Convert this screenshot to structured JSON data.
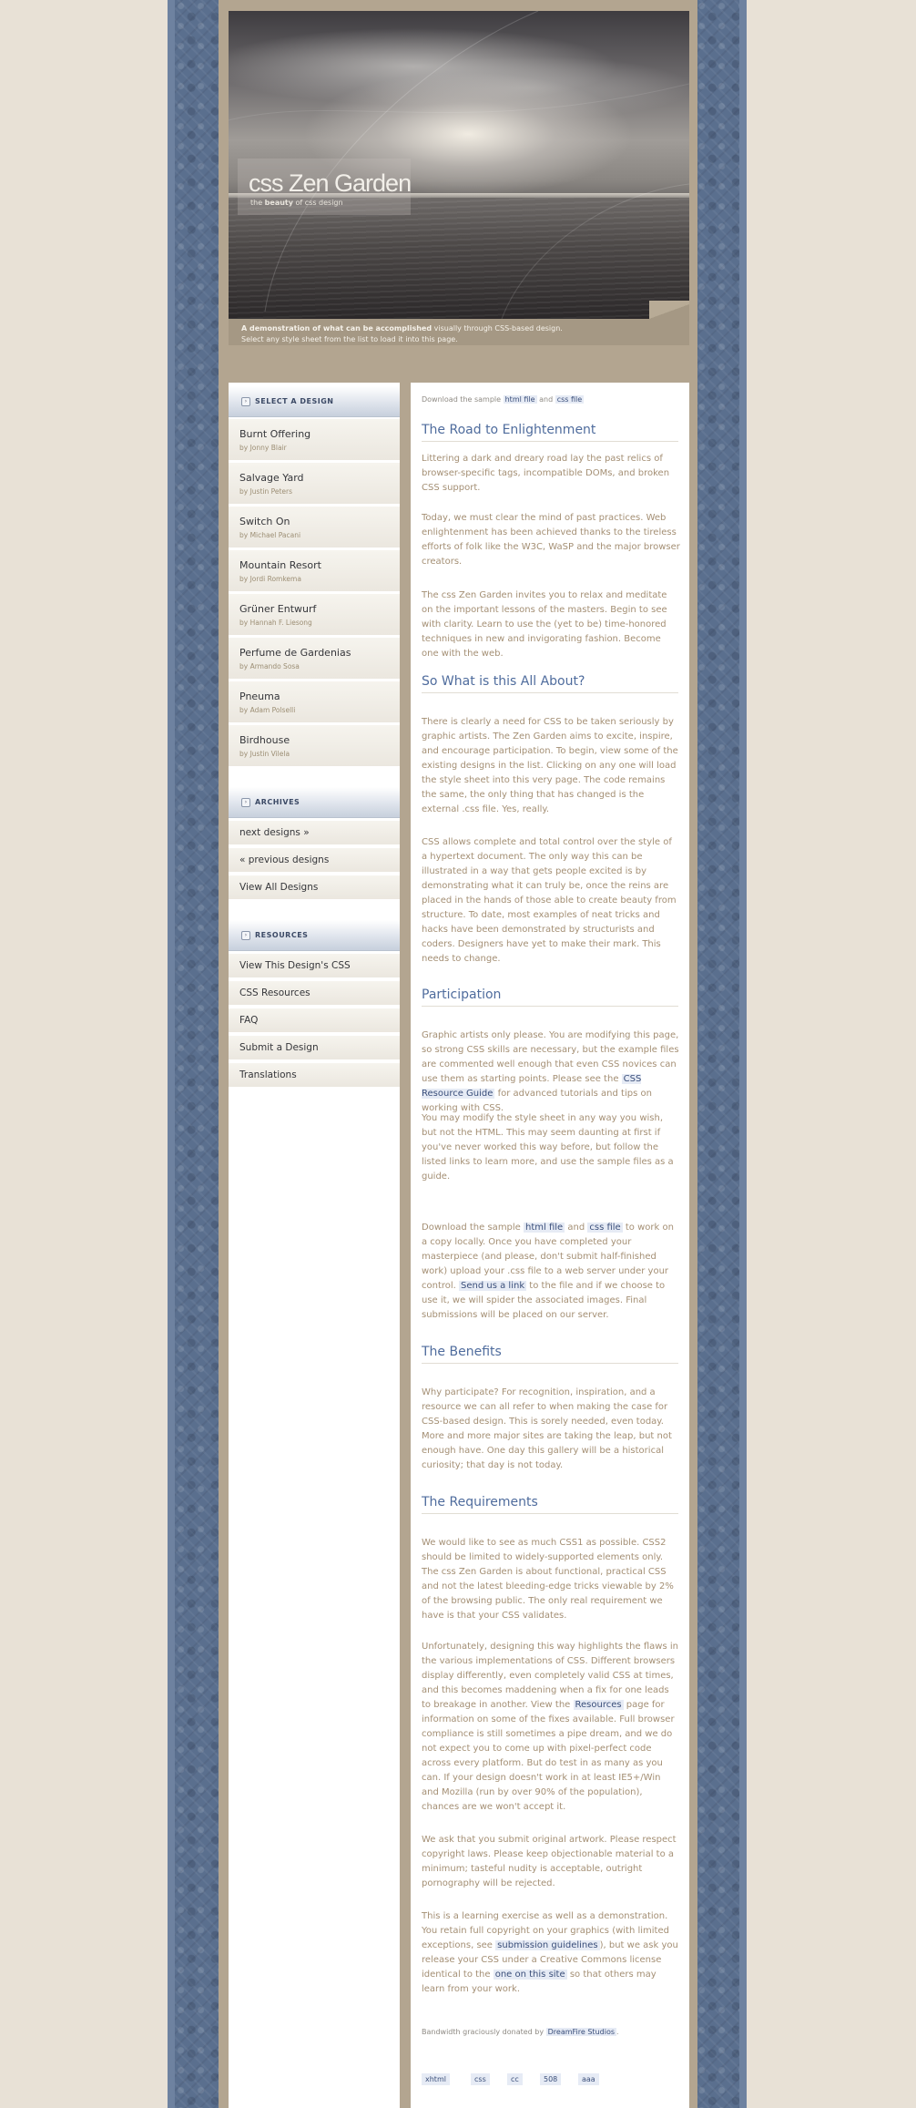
{
  "header": {
    "site_title": "css Zen Garden",
    "tagline_pre": "the ",
    "tagline_bold": "beauty",
    "tagline_post": " of css design",
    "summary_bold": "A demonstration of what can be accomplished",
    "summary_rest": " visually through CSS-based design.",
    "summary_line2": "Select any style sheet from the list to load it into this page."
  },
  "sidebar": {
    "select_heading": "SELECT A DESIGN",
    "designs": [
      {
        "name": "Burnt Offering",
        "author": "by Jonny Blair"
      },
      {
        "name": "Salvage Yard",
        "author": "by Justin Peters"
      },
      {
        "name": "Switch On",
        "author": "by Michael Pacani"
      },
      {
        "name": "Mountain Resort",
        "author": "by Jordi Romkema"
      },
      {
        "name": "Grüner Entwurf",
        "author": "by Hannah F. Liesong"
      },
      {
        "name": "Perfume de Gardenias",
        "author": "by Armando Sosa"
      },
      {
        "name": "Pneuma",
        "author": "by Adam Polselli"
      },
      {
        "name": "Birdhouse",
        "author": "by Justin Vilela"
      }
    ],
    "archives_heading": "ARCHIVES",
    "archives": [
      "next designs »",
      "« previous designs",
      "View All Designs"
    ],
    "resources_heading": "RESOURCES",
    "resources": [
      "View This Design's CSS",
      "CSS Resources",
      "FAQ",
      "Submit a Design",
      "Translations"
    ]
  },
  "main": {
    "download_pre": "Download the sample ",
    "html_file": "html file",
    "and": " and ",
    "css_file": "css file",
    "h_road": "The Road to Enlightenment",
    "p_road1": "Littering a dark and dreary road lay the past relics of browser-specific tags, incompatible DOMs, and broken CSS support.",
    "p_road2": "Today, we must clear the mind of past practices. Web enlightenment has been achieved thanks to the tireless efforts of folk like the W3C, WaSP and the major browser creators.",
    "p_road3": "The css Zen Garden invites you to relax and meditate on the important lessons of the masters. Begin to see with clarity. Learn to use the (yet to be) time-honored techniques in new and invigorating fashion. Become one with the web.",
    "h_what": "So What is this All About?",
    "p_what1": "There is clearly a need for CSS to be taken seriously by graphic artists. The Zen Garden aims to excite, inspire, and encourage participation. To begin, view some of the existing designs in the list. Clicking on any one will load the style sheet into this very page. The code remains the same, the only thing that has changed is the external .css file. Yes, really.",
    "p_what2": "CSS allows complete and total control over the style of a hypertext document. The only way this can be illustrated in a way that gets people excited is by demonstrating what it can truly be, once the reins are placed in the hands of those able to create beauty from structure. To date, most examples of neat tricks and hacks have been demonstrated by structurists and coders. Designers have yet to make their mark. This needs to change.",
    "h_part": "Participation",
    "p_part1_pre": "Graphic artists only please. You are modifying this page, so strong CSS skills are necessary, but the example files are commented well enough that even CSS novices can use them as starting points. Please see the ",
    "p_part1_link": "CSS Resource Guide",
    "p_part1_post": " for advanced tutorials and tips on working with CSS.",
    "p_part2": "You may modify the style sheet in any way you wish, but not the HTML. This may seem daunting at first if you've never worked this way before, but follow the listed links to learn more, and use the sample files as a guide.",
    "p_part3_a": "Download the sample ",
    "p_part3_html": "html file",
    "p_part3_b": " and ",
    "p_part3_css": "css file",
    "p_part3_c": " to work on a copy locally. Once you have completed your masterpiece (and please, don't submit half-finished work) upload your .css file to a web server under your control. ",
    "p_part3_link": "Send us a link",
    "p_part3_d": " to the file and if we choose to use it, we will spider the associated images. Final submissions will be placed on our server.",
    "h_benefits": "The Benefits",
    "p_benefits": "Why participate? For recognition, inspiration, and a resource we can all refer to when making the case for CSS-based design. This is sorely needed, even today. More and more major sites are taking the leap, but not enough have. One day this gallery will be a historical curiosity; that day is not today.",
    "h_req": "The Requirements",
    "p_req1": "We would like to see as much CSS1 as possible. CSS2 should be limited to widely-supported elements only. The css Zen Garden is about functional, practical CSS and not the latest bleeding-edge tricks viewable by 2% of the browsing public. The only real requirement we have is that your CSS validates.",
    "p_req2_pre": "Unfortunately, designing this way highlights the flaws in the various implementations of CSS. Different browsers display differently, even completely valid CSS at times, and this becomes maddening when a fix for one leads to breakage in another. View the ",
    "p_req2_link": "Resources",
    "p_req2_post": " page for information on some of the fixes available. Full browser compliance is still sometimes a pipe dream, and we do not expect you to come up with pixel-perfect code across every platform. But do test in as many as you can. If your design doesn't work in at least IE5+/Win and Mozilla (run by over 90% of the population), chances are we won't accept it.",
    "p_req3": "We ask that you submit original artwork. Please respect copyright laws. Please keep objectionable material to a minimum; tasteful nudity is acceptable, outright pornography will be rejected.",
    "p_req4_a": "This is a learning exercise as well as a demonstration. You retain full copyright on your graphics (with limited exceptions, see ",
    "p_req4_link1": "submission guidelines",
    "p_req4_b": "), but we ask you release your CSS under a Creative Commons license identical to the ",
    "p_req4_link2": "one on this site",
    "p_req4_c": " so that others may learn from your work.",
    "bandwidth_pre": "Bandwidth graciously donated by ",
    "bandwidth_link": "DreamFire Studios",
    "bandwidth_post": ".",
    "footer_links": [
      "xhtml",
      "css",
      "cc",
      "508",
      "aaa"
    ]
  }
}
